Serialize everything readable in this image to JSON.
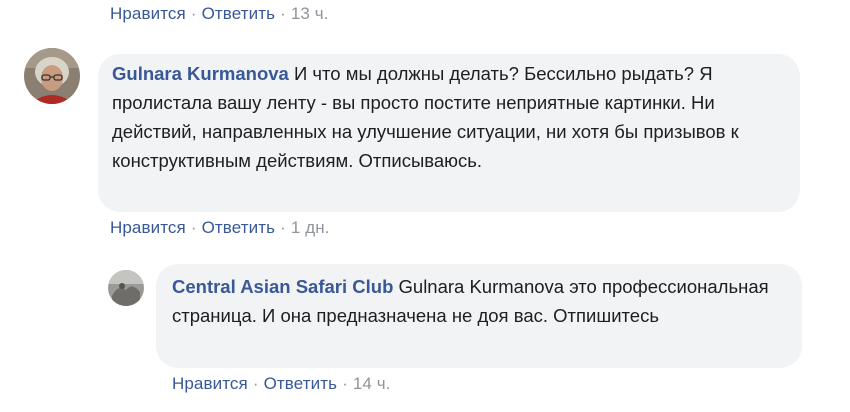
{
  "top_actions": {
    "like": "Нравится",
    "reply": "Ответить",
    "time": "13 ч."
  },
  "comment1": {
    "author": "Gulnara Kurmanova",
    "text": "И что мы должны делать? Бессильно рыдать? Я пролистала вашу ленту - вы просто постите неприятные картинки. Ни действий, направленных на улучшение ситуации, ни хотя бы призывов к конструктивным действиям. Отписываюсь.",
    "actions": {
      "like": "Нравится",
      "reply": "Ответить",
      "time": "1 дн."
    }
  },
  "reply1": {
    "author": "Central Asian Safari Club",
    "mention": "Gulnara Kurmanova",
    "text": "это профессиональная страница. И она предназначена не доя вас. Отпишитесь",
    "actions": {
      "like": "Нравится",
      "reply": "Ответить",
      "time": "14 ч."
    }
  },
  "separator": "·",
  "colors": {
    "link": "#385898",
    "bubble": "#f2f3f5",
    "meta": "#90949c"
  }
}
